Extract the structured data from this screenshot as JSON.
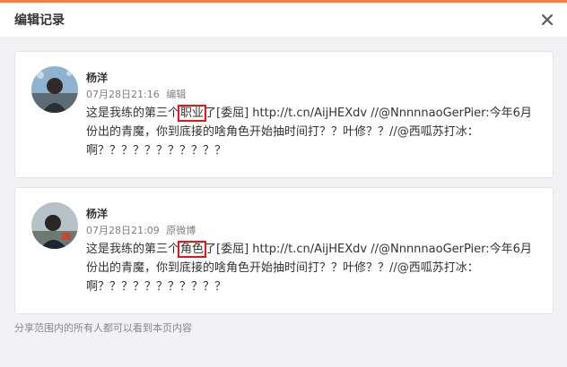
{
  "dialog": {
    "title": "编辑记录"
  },
  "entries": [
    {
      "author": "杨洋",
      "time": "07月28日21:16",
      "action": "编辑",
      "text_before": "这是我练的第三个",
      "highlight": "职业",
      "text_after": "了[委屈] http://t.cn/AijHEXdv //@NnnnnaoGerPier:今年6月份出的青魔，你到底接的啥角色开始抽时间打？？叶修？？//@西呱苏打冰：啊？？？？？？？？？？？"
    },
    {
      "author": "杨洋",
      "time": "07月28日21:09",
      "action": "原微博",
      "text_before": "这是我练的第三个",
      "highlight": "角色",
      "text_after": "了[委屈] http://t.cn/AijHEXdv //@NnnnnaoGerPier:今年6月份出的青魔，你到底接的啥角色开始抽时间打？？叶修？？//@西呱苏打冰：啊？？？？？？？？？？？"
    }
  ],
  "footer": {
    "note": "分享范围内的所有人都可以看到本页内容"
  },
  "colors": {
    "accent": "#fa7d3c",
    "highlight_box": "#e8141a"
  }
}
